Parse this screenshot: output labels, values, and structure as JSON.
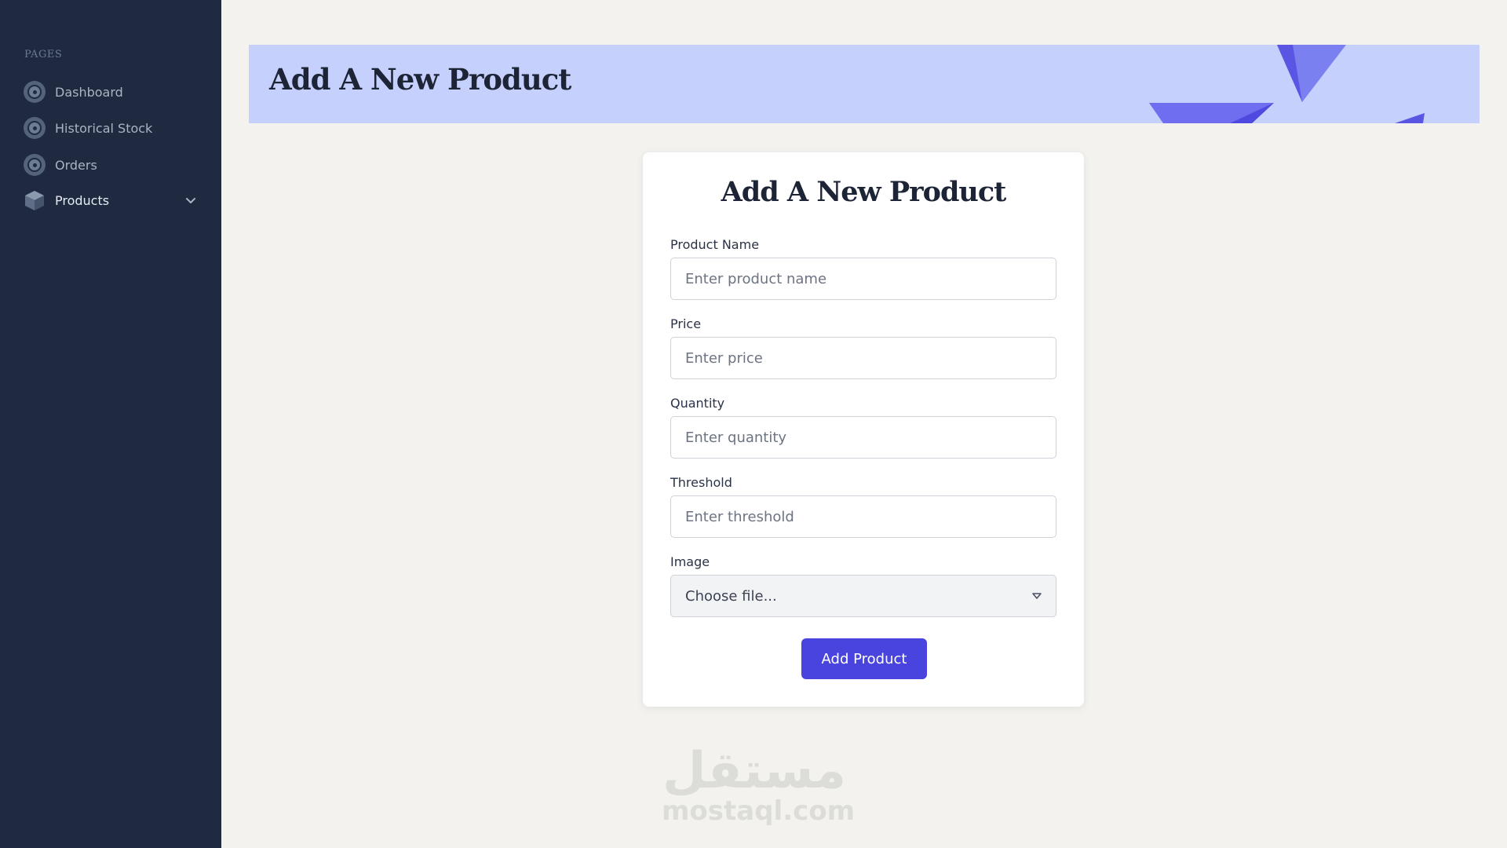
{
  "sidebar": {
    "section_title": "PAGES",
    "items": [
      {
        "label": "Dashboard",
        "icon": "dashboard-icon"
      },
      {
        "label": "Historical Stock",
        "icon": "historical-stock-icon"
      },
      {
        "label": "Orders",
        "icon": "orders-icon"
      },
      {
        "label": "Products",
        "icon": "box-icon",
        "expandable": true,
        "active": true
      }
    ]
  },
  "header": {
    "title": "Add A New Product"
  },
  "form": {
    "title": "Add A New Product",
    "fields": [
      {
        "label": "Product Name",
        "placeholder": "Enter product name"
      },
      {
        "label": "Price",
        "placeholder": "Enter price"
      },
      {
        "label": "Quantity",
        "placeholder": "Enter quantity"
      },
      {
        "label": "Threshold",
        "placeholder": "Enter threshold"
      }
    ],
    "image": {
      "label": "Image",
      "value": "Choose file..."
    },
    "submit_label": "Add Product"
  },
  "watermark": {
    "logo_text": "مستقل",
    "text": "mostaql.com"
  },
  "colors": {
    "sidebar_bg": "#1f2a40",
    "page_bg": "#f3f2ee",
    "banner_bg": "#c6d0fc",
    "accent": "#4a44de"
  }
}
